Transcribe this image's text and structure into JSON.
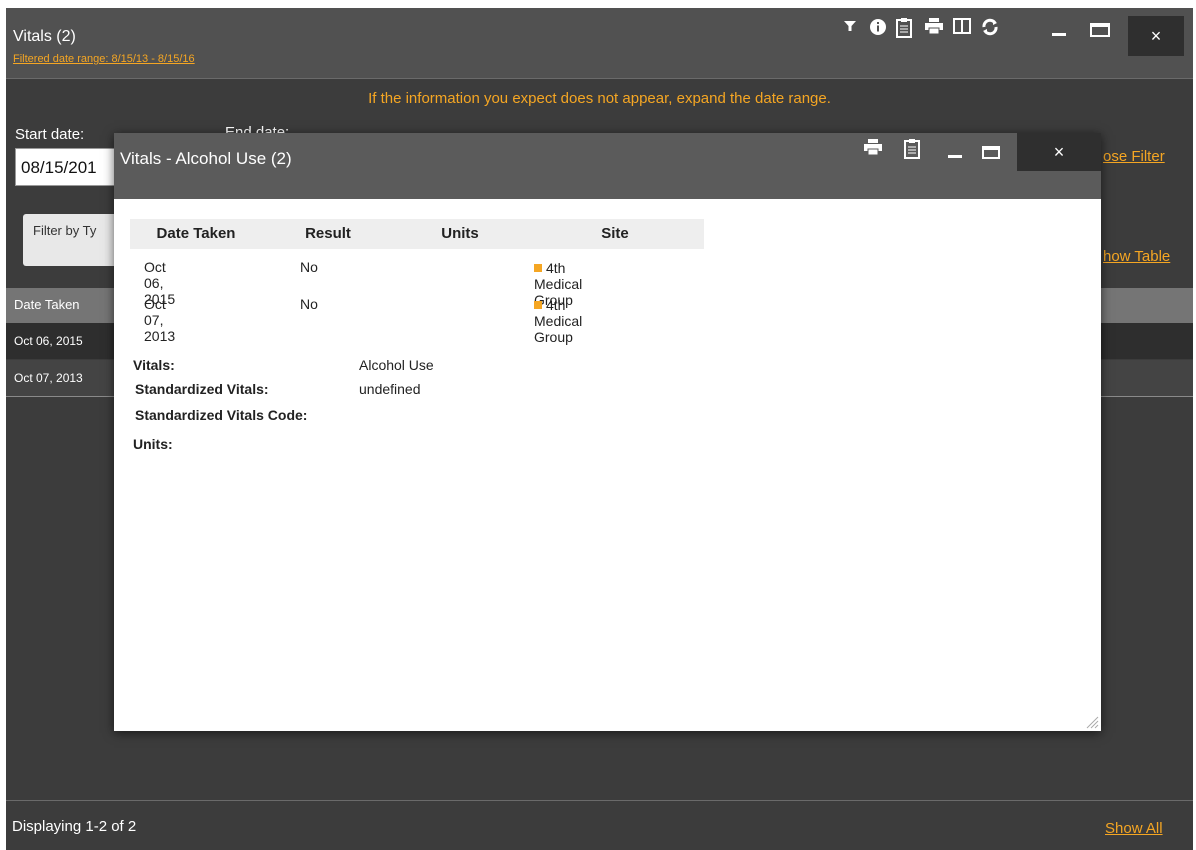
{
  "panel": {
    "title": "Vitals (2)",
    "filtered_range": "Filtered date range: 8/15/13 - 8/15/16",
    "toolbar_icons": [
      "filter-icon",
      "info-icon",
      "clipboard-icon",
      "print-icon",
      "columns-icon",
      "refresh-icon",
      "minimize-icon",
      "maximize-icon",
      "close-icon"
    ],
    "close_label": "×",
    "notice": "If the information you expect does not appear, expand the date range.",
    "start_label": "Start date:",
    "end_label": "End date:",
    "start_value": "08/15/201",
    "filter_type_label": "Filter by Ty",
    "choose_filter": "ose Filter",
    "show_table": "how Table",
    "column_header": "Date Taken",
    "rows": [
      "Oct 06, 2015",
      "Oct 07, 2013"
    ],
    "displaying": "Displaying 1-2 of 2",
    "show_all": "Show All"
  },
  "modal": {
    "title": "Vitals - Alcohol Use (2)",
    "close_label": "×",
    "headers": [
      "Date Taken",
      "Result",
      "Units",
      "Site"
    ],
    "rows": [
      {
        "date": "Oct 06, 2015",
        "result": "No",
        "units": "",
        "site": "4th Medical Group"
      },
      {
        "date": "Oct 07, 2013",
        "result": "No",
        "units": "",
        "site": "4th Medical Group"
      }
    ],
    "details": {
      "vitals_label": "Vitals:",
      "vitals_value": "Alcohol Use",
      "std_label": "Standardized Vitals:",
      "std_value": "undefined",
      "std_code_label": "Standardized Vitals Code:",
      "units_label": "Units:"
    }
  },
  "colors": {
    "accent": "#f5a623",
    "panel_bg": "#3c3c3c",
    "titlebar": "#515151"
  }
}
